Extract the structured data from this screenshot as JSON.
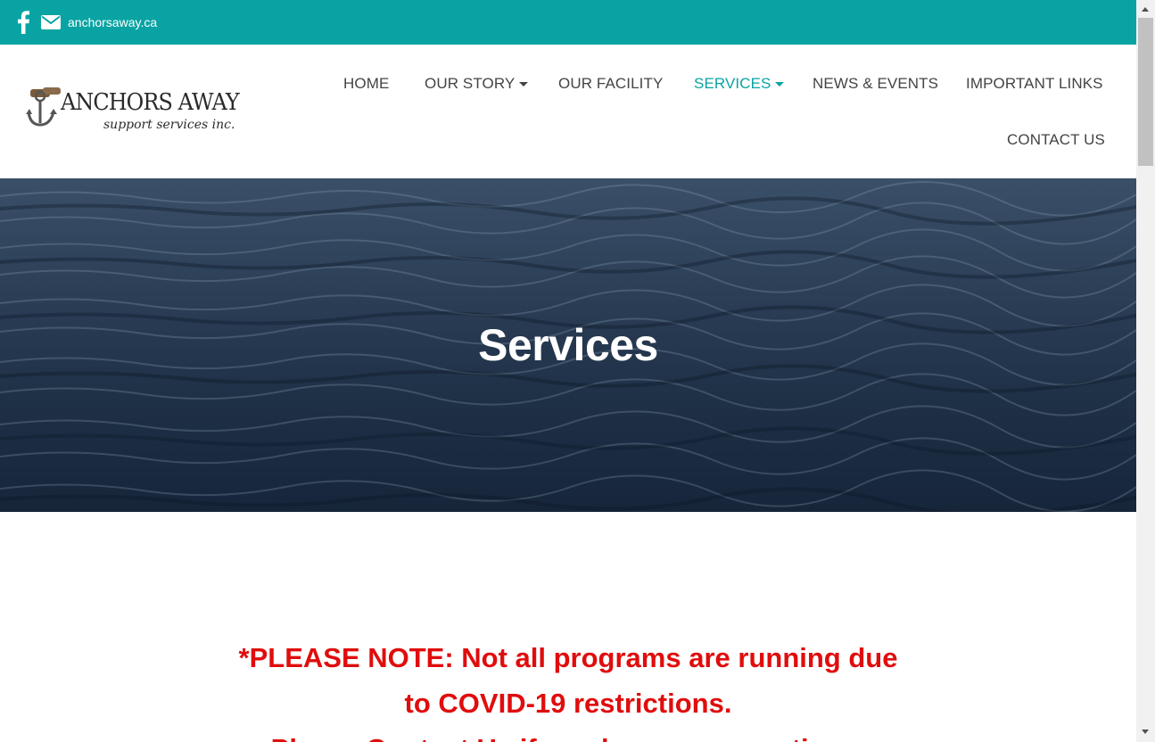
{
  "topbar": {
    "facebook_icon": "facebook-icon",
    "email_icon": "envelope-icon",
    "site_link": "anchorsaway.ca"
  },
  "logo": {
    "brand": "ANCHORS AWAY",
    "tagline": "support services inc."
  },
  "nav": {
    "items": [
      {
        "label": "HOME"
      },
      {
        "label": "OUR STORY",
        "dropdown": true
      },
      {
        "label": "OUR FACILITY"
      },
      {
        "label": "SERVICES",
        "dropdown": true,
        "active": true
      },
      {
        "label": "NEWS & EVENTS"
      },
      {
        "label": "IMPORTANT LINKS"
      },
      {
        "label": "CONTACT US"
      }
    ]
  },
  "hero": {
    "title": "Services"
  },
  "notice": {
    "line1": "*PLEASE NOTE: Not all programs are running due",
    "line2": "to COVID-19 restrictions.",
    "line3": "Please Contact Us if you have any questions."
  },
  "colors": {
    "accent": "#0aa3a3",
    "nav_text": "#444444",
    "notice": "#e00d0d"
  }
}
